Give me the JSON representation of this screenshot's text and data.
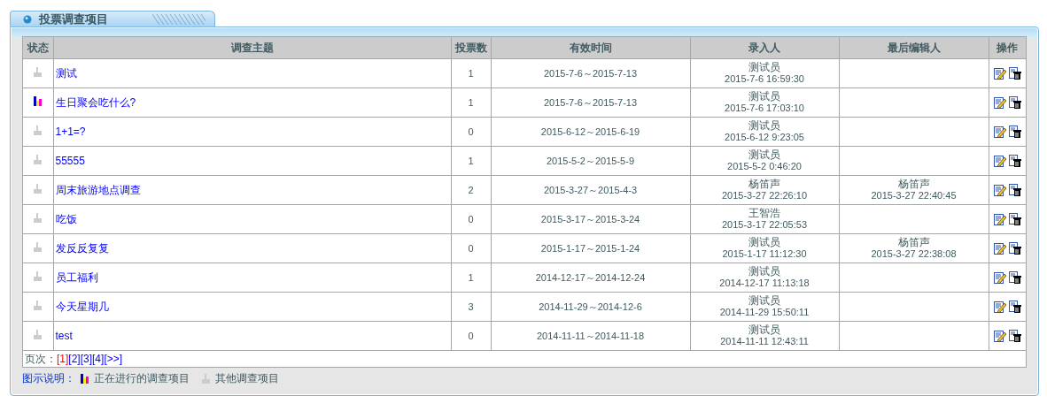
{
  "panel": {
    "title": "投票调查项目"
  },
  "table": {
    "columns": [
      "状态",
      "调查主题",
      "投票数",
      "有效时间",
      "录入人",
      "最后编辑人",
      "操作"
    ],
    "rows": [
      {
        "active": false,
        "title": "测试",
        "votes": "1",
        "period": "2015-7-6～2015-7-13",
        "creator": "测试员",
        "created_at": "2015-7-6 16:59:30"
      },
      {
        "active": true,
        "title": "生日聚会吃什么?",
        "votes": "1",
        "period": "2015-7-6～2015-7-13",
        "creator": "测试员",
        "created_at": "2015-7-6 17:03:10"
      },
      {
        "active": false,
        "title": "1+1=?",
        "votes": "0",
        "period": "2015-6-12～2015-6-19",
        "creator": "测试员",
        "created_at": "2015-6-12 9:23:05"
      },
      {
        "active": false,
        "title": "55555",
        "votes": "1",
        "period": "2015-5-2～2015-5-9",
        "creator": "测试员",
        "created_at": "2015-5-2 0:46:20"
      },
      {
        "active": false,
        "title": "周末旅游地点调查",
        "votes": "2",
        "period": "2015-3-27～2015-4-3",
        "creator": "杨笛声",
        "created_at": "2015-3-27 22:26:10",
        "editor": "杨笛声",
        "edited_at": "2015-3-27 22:40:45"
      },
      {
        "active": false,
        "title": "吃饭",
        "votes": "0",
        "period": "2015-3-17～2015-3-24",
        "creator": "王智浩",
        "created_at": "2015-3-17 22:05:53"
      },
      {
        "active": false,
        "title": "发反反复复",
        "votes": "0",
        "period": "2015-1-17～2015-1-24",
        "creator": "测试员",
        "created_at": "2015-1-17 11:12:30",
        "editor": "杨笛声",
        "edited_at": "2015-3-27 22:38:08"
      },
      {
        "active": false,
        "title": "员工福利",
        "votes": "1",
        "period": "2014-12-17～2014-12-24",
        "creator": "测试员",
        "created_at": "2014-12-17 11:13:18"
      },
      {
        "active": false,
        "title": "今天星期几",
        "votes": "3",
        "period": "2014-11-29～2014-12-6",
        "creator": "测试员",
        "created_at": "2014-11-29 15:50:11"
      },
      {
        "active": false,
        "title": "test",
        "votes": "0",
        "period": "2014-11-11～2014-11-18",
        "creator": "测试员",
        "created_at": "2014-11-11 12:43:11"
      }
    ]
  },
  "pager": {
    "label": "页次：",
    "pages": [
      {
        "label": "[1]",
        "selected": true
      },
      {
        "label": "[2]",
        "selected": false
      },
      {
        "label": "[3]",
        "selected": false
      },
      {
        "label": "[4]",
        "selected": false
      },
      {
        "label": "[>>]",
        "selected": false
      }
    ]
  },
  "legend": {
    "label": "图示说明：",
    "items": [
      {
        "active": true,
        "text": "正在进行的调查项目"
      },
      {
        "active": false,
        "text": "其他调查项目"
      }
    ]
  }
}
